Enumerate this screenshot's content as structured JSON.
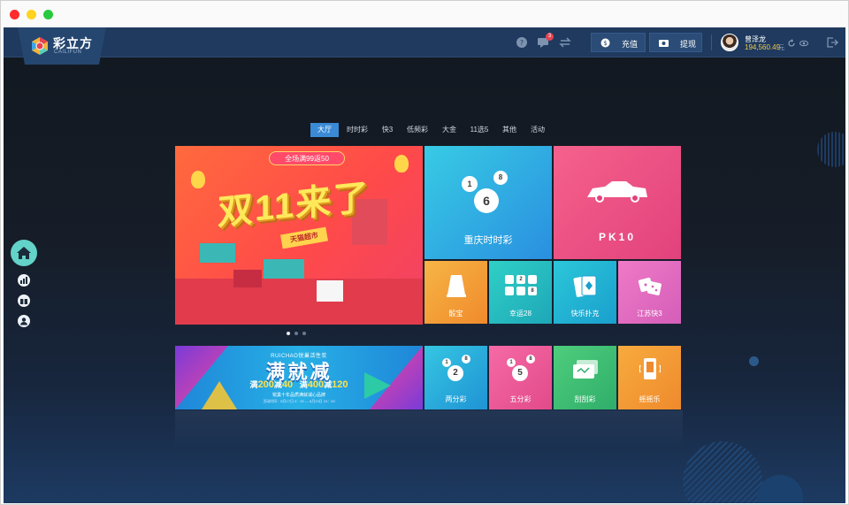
{
  "window": {
    "dot_colors": [
      "#ff2d2d",
      "#ffd21f",
      "#27c93f"
    ]
  },
  "header": {
    "logo_cn": "彩立方",
    "logo_en": "CAILIFUN",
    "notification_count": "3",
    "recharge_label": "充值",
    "withdraw_label": "提现",
    "user_name": "曾泽龙",
    "user_balance": "194,560.49",
    "balance_unit": "元"
  },
  "sidebar": {
    "items": [
      "home-icon",
      "chart-icon",
      "gift-icon",
      "user-icon"
    ]
  },
  "nav": {
    "tabs": [
      {
        "label": "大厅",
        "active": true
      },
      {
        "label": "时时彩",
        "active": false
      },
      {
        "label": "快3",
        "active": false
      },
      {
        "label": "低频彩",
        "active": false
      },
      {
        "label": "大金",
        "active": false
      },
      {
        "label": "11选5",
        "active": false
      },
      {
        "label": "其他",
        "active": false
      },
      {
        "label": "活动",
        "active": false
      }
    ]
  },
  "banner_main": {
    "slogan": "全场满99返50",
    "headline": "双11来了",
    "tag": "天猫超市",
    "slide_count": 3,
    "active_slide": 1
  },
  "banner_promo": {
    "brand": "RUICHAO锐巢活性炭",
    "headline": "满就减",
    "offer_1_prefix": "满",
    "offer_1_amount": "200",
    "offer_1_mid": "减",
    "offer_1_value": "40",
    "offer_2_prefix": "满",
    "offer_2_amount": "400",
    "offer_2_mid": "减",
    "offer_2_value": "120",
    "subline": "锐巢十年品质满就减心品牌",
    "small_print": "活动时间：8月17日 0：00 — 8月23日 24：00"
  },
  "games": {
    "cqssc": {
      "label": "重庆时时彩",
      "balls": [
        "1",
        "6",
        "8"
      ],
      "color": "#2fb6e6"
    },
    "pk10": {
      "label": "PK10",
      "color": "#f04e84"
    },
    "shaibao": {
      "label": "骰宝",
      "color": "#f3a23a"
    },
    "xingyun28": {
      "label": "幸运28",
      "balls": [
        "2",
        "8"
      ],
      "color": "#25c3c0"
    },
    "poker": {
      "label": "快乐扑克",
      "color": "#25b7d6"
    },
    "jsk3": {
      "label": "江苏快3",
      "color": "#e46dc3"
    },
    "liangfen": {
      "label": "两分彩",
      "balls": [
        "1",
        "2",
        "8"
      ],
      "color": "#26b5dc"
    },
    "wufen": {
      "label": "五分彩",
      "balls": [
        "1",
        "5",
        "8"
      ],
      "color": "#ea5a9a"
    },
    "guagua": {
      "label": "刮刮彩",
      "color": "#3ec07a"
    },
    "yaoyao": {
      "label": "摇摇乐",
      "color": "#f39a34"
    }
  }
}
